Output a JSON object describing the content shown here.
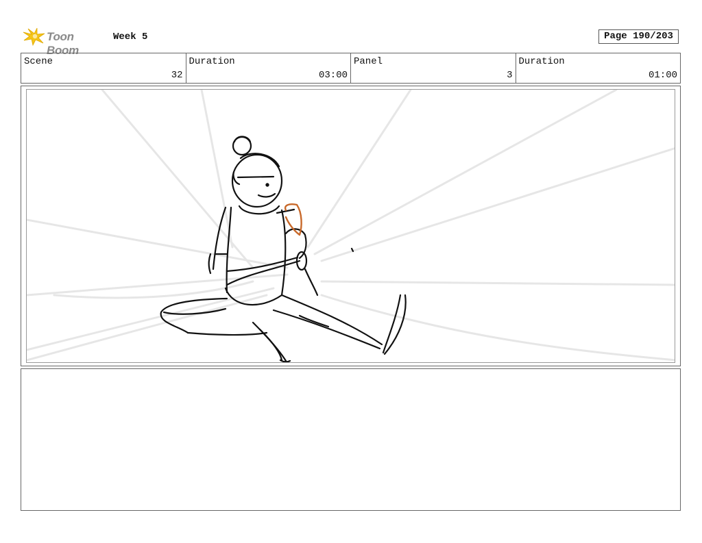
{
  "header": {
    "logo_text": "Toon Boom",
    "title": "Week 5",
    "page": "Page 190/203"
  },
  "info": {
    "scene_label": "Scene",
    "scene_value": "32",
    "scene_duration_label": "Duration",
    "scene_duration_value": "03:00",
    "panel_label": "Panel",
    "panel_value": "3",
    "panel_duration_label": "Duration",
    "panel_duration_value": "01:00"
  },
  "colors": {
    "logo_accent": "#f5c518",
    "sketch_line": "#111111",
    "speed_lines": "#e6e6e6",
    "highlight_stroke": "#c8692a"
  },
  "icons": {
    "logo": "toon-boom-star-icon"
  }
}
